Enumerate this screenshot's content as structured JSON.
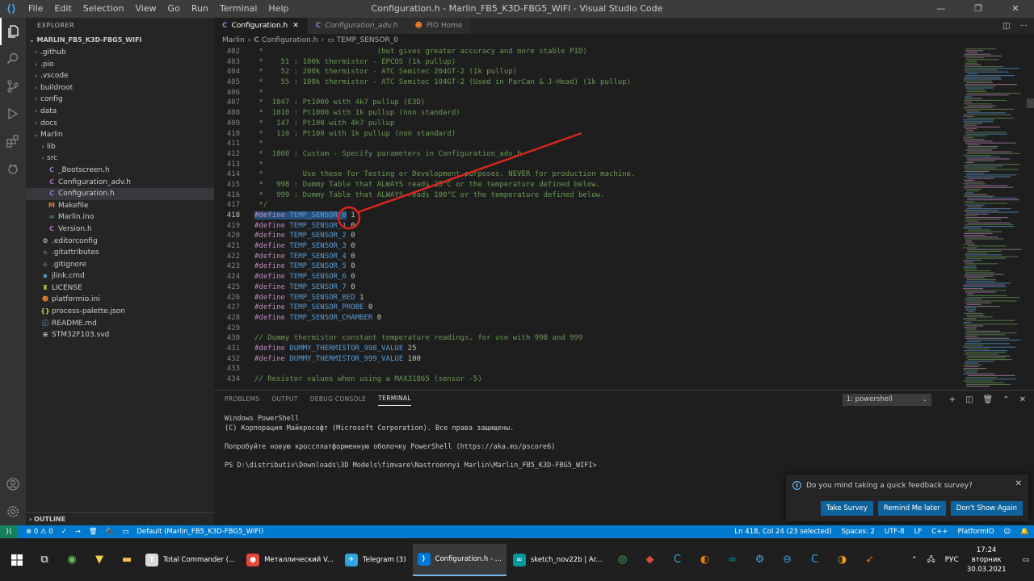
{
  "titlebar": {
    "menu": [
      "File",
      "Edit",
      "Selection",
      "View",
      "Go",
      "Run",
      "Terminal",
      "Help"
    ],
    "title": "Configuration.h - Marlin_FB5_K3D-FBG5_WIFI - Visual Studio Code"
  },
  "sidebar": {
    "header": "EXPLORER",
    "project": "MARLIN_FB5_K3D-FBG5_WIFI",
    "outline": "OUTLINE",
    "items": [
      {
        "label": ".github",
        "indent": 1,
        "chevron": "›",
        "icon": "",
        "color": "#cccccc"
      },
      {
        "label": ".pio",
        "indent": 1,
        "chevron": "›",
        "icon": "",
        "color": "#cccccc"
      },
      {
        "label": ".vscode",
        "indent": 1,
        "chevron": "›",
        "icon": "",
        "color": "#cccccc"
      },
      {
        "label": "buildroot",
        "indent": 1,
        "chevron": "›",
        "icon": "",
        "color": "#cccccc"
      },
      {
        "label": "config",
        "indent": 1,
        "chevron": "›",
        "icon": "",
        "color": "#cccccc"
      },
      {
        "label": "data",
        "indent": 1,
        "chevron": "›",
        "icon": "",
        "color": "#cccccc"
      },
      {
        "label": "docs",
        "indent": 1,
        "chevron": "›",
        "icon": "",
        "color": "#cccccc"
      },
      {
        "label": "Marlin",
        "indent": 1,
        "chevron": "⌄",
        "icon": "",
        "color": "#cccccc"
      },
      {
        "label": "lib",
        "indent": 2,
        "chevron": "›",
        "icon": "",
        "color": "#cccccc"
      },
      {
        "label": "src",
        "indent": 2,
        "chevron": "›",
        "icon": "",
        "color": "#cccccc"
      },
      {
        "label": "_Bootscreen.h",
        "indent": 2,
        "chevron": "",
        "icon": "C",
        "color": "#a074c4"
      },
      {
        "label": "Configuration_adv.h",
        "indent": 2,
        "chevron": "",
        "icon": "C",
        "color": "#a074c4"
      },
      {
        "label": "Configuration.h",
        "indent": 2,
        "chevron": "",
        "icon": "C",
        "color": "#a074c4",
        "selected": true
      },
      {
        "label": "Makefile",
        "indent": 2,
        "chevron": "",
        "icon": "M",
        "color": "#e37933"
      },
      {
        "label": "Marlin.ino",
        "indent": 2,
        "chevron": "",
        "icon": "∞",
        "color": "#519aba"
      },
      {
        "label": "Version.h",
        "indent": 2,
        "chevron": "",
        "icon": "C",
        "color": "#a074c4"
      },
      {
        "label": ".editorconfig",
        "indent": 1,
        "chevron": "",
        "icon": "⚙",
        "color": "#cccccc"
      },
      {
        "label": ".gitattributes",
        "indent": 1,
        "chevron": "",
        "icon": "◆",
        "color": "#41535b"
      },
      {
        "label": ".gitignore",
        "indent": 1,
        "chevron": "",
        "icon": "◆",
        "color": "#41535b"
      },
      {
        "label": "jlink.cmd",
        "indent": 1,
        "chevron": "",
        "icon": "▪",
        "color": "#519aba"
      },
      {
        "label": "LICENSE",
        "indent": 1,
        "chevron": "",
        "icon": "♜",
        "color": "#cbcb41"
      },
      {
        "label": "platformio.ini",
        "indent": 1,
        "chevron": "",
        "icon": "☻",
        "color": "#f5822a"
      },
      {
        "label": "process-palette.json",
        "indent": 1,
        "chevron": "",
        "icon": "{}",
        "color": "#cbcb41"
      },
      {
        "label": "README.md",
        "indent": 1,
        "chevron": "",
        "icon": "ⓘ",
        "color": "#519aba"
      },
      {
        "label": "STM32F103.svd",
        "indent": 1,
        "chevron": "",
        "icon": "≡",
        "color": "#cccccc"
      }
    ]
  },
  "tabs": [
    {
      "label": "Configuration.h",
      "active": true,
      "italic": false,
      "close": "✕"
    },
    {
      "label": "Configuration_adv.h",
      "active": false,
      "italic": true,
      "close": ""
    },
    {
      "label": "PIO Home",
      "active": false,
      "italic": false,
      "close": ""
    }
  ],
  "breadcrumb": [
    "Marlin",
    "Configuration.h",
    "TEMP_SENSOR_0"
  ],
  "code": [
    {
      "n": "402",
      "t": " *                          (but gives greater accuracy and more stable PID)",
      "k": "com"
    },
    {
      "n": "403",
      "t": " *    51 : 100k thermistor - EPCOS (1k pullup)",
      "k": "com"
    },
    {
      "n": "404",
      "t": " *    52 : 200k thermistor - ATC Semitec 204GT-2 (1k pullup)",
      "k": "com"
    },
    {
      "n": "405",
      "t": " *    55 : 100k thermistor - ATC Semitec 104GT-2 (Used in ParCan & J-Head) (1k pullup)",
      "k": "com"
    },
    {
      "n": "406",
      "t": " *",
      "k": "com"
    },
    {
      "n": "407",
      "t": " *  1047 : Pt1000 with 4k7 pullup (E3D)",
      "k": "com"
    },
    {
      "n": "408",
      "t": " *  1010 : Pt1000 with 1k pullup (non standard)",
      "k": "com"
    },
    {
      "n": "409",
      "t": " *   147 : Pt100 with 4k7 pullup",
      "k": "com"
    },
    {
      "n": "410",
      "t": " *   110 : Pt100 with 1k pullup (non standard)",
      "k": "com"
    },
    {
      "n": "411",
      "t": " *",
      "k": "com"
    },
    {
      "n": "412",
      "t": " *  1000 : Custom - Specify parameters in Configuration_adv.h",
      "k": "com"
    },
    {
      "n": "413",
      "t": " *",
      "k": "com"
    },
    {
      "n": "414",
      "t": " *         Use these for Testing or Development purposes. NEVER for production machine.",
      "k": "com"
    },
    {
      "n": "415",
      "t": " *   998 : Dummy Table that ALWAYS reads 25°C or the temperature defined below.",
      "k": "com"
    },
    {
      "n": "416",
      "t": " *   999 : Dummy Table that ALWAYS reads 100°C or the temperature defined below.",
      "k": "com"
    },
    {
      "n": "417",
      "t": " */",
      "k": "com"
    },
    {
      "n": "418",
      "kw": "#define",
      "mac": "TEMP_SENSOR_0",
      "val": "1",
      "k": "def",
      "sel": true
    },
    {
      "n": "419",
      "kw": "#define",
      "mac": "TEMP_SENSOR_1",
      "val": "0",
      "k": "def"
    },
    {
      "n": "420",
      "kw": "#define",
      "mac": "TEMP_SENSOR_2",
      "val": "0",
      "k": "def"
    },
    {
      "n": "421",
      "kw": "#define",
      "mac": "TEMP_SENSOR_3",
      "val": "0",
      "k": "def"
    },
    {
      "n": "422",
      "kw": "#define",
      "mac": "TEMP_SENSOR_4",
      "val": "0",
      "k": "def"
    },
    {
      "n": "423",
      "kw": "#define",
      "mac": "TEMP_SENSOR_5",
      "val": "0",
      "k": "def"
    },
    {
      "n": "424",
      "kw": "#define",
      "mac": "TEMP_SENSOR_6",
      "val": "0",
      "k": "def"
    },
    {
      "n": "425",
      "kw": "#define",
      "mac": "TEMP_SENSOR_7",
      "val": "0",
      "k": "def"
    },
    {
      "n": "426",
      "kw": "#define",
      "mac": "TEMP_SENSOR_BED",
      "val": "1",
      "k": "def"
    },
    {
      "n": "427",
      "kw": "#define",
      "mac": "TEMP_SENSOR_PROBE",
      "val": "0",
      "k": "def"
    },
    {
      "n": "428",
      "kw": "#define",
      "mac": "TEMP_SENSOR_CHAMBER",
      "val": "0",
      "k": "def"
    },
    {
      "n": "429",
      "t": "",
      "k": "plain"
    },
    {
      "n": "430",
      "t": "// Dummy thermistor constant temperature readings, for use with 998 and 999",
      "k": "com"
    },
    {
      "n": "431",
      "kw": "#define",
      "mac": "DUMMY_THERMISTOR_998_VALUE",
      "val": "25",
      "k": "def"
    },
    {
      "n": "432",
      "kw": "#define",
      "mac": "DUMMY_THERMISTOR_999_VALUE",
      "val": "100",
      "k": "def"
    },
    {
      "n": "433",
      "t": "",
      "k": "plain"
    },
    {
      "n": "434",
      "t": "// Resistor values when using a MAX31865 (sensor -5)",
      "k": "com"
    }
  ],
  "panel": {
    "tabs": [
      "PROBLEMS",
      "OUTPUT",
      "DEBUG CONSOLE",
      "TERMINAL"
    ],
    "active_tab": "TERMINAL",
    "terminal_select": "1: powershell",
    "terminal_lines": [
      "Windows PowerShell",
      "(C) Корпорация Майкрософт (Microsoft Corporation). Все права защищены.",
      "",
      "Попробуйте новую кроссплатформенную оболочку PowerShell (https://aka.ms/pscore6)",
      "",
      "PS D:\\distributiv\\Downloads\\3D Models\\fimvare\\Nastroennyi Marlin\\Marlin_FB5_K3D-FBG5_WIFI>"
    ]
  },
  "toast": {
    "message": "Do you mind taking a quick feedback survey?",
    "buttons": [
      "Take Survey",
      "Remind Me later",
      "Don't Show Again"
    ]
  },
  "statusbar": {
    "errors": "⊗ 0 ⚠ 0",
    "left_icons": [
      "✓",
      "→",
      "🗑",
      "🔌",
      "▭"
    ],
    "env": "Default (Marlin_FB5_K3D-FBG5_WIFI)",
    "position": "Ln 418, Col 24 (23 selected)",
    "spaces": "Spaces: 2",
    "encoding": "UTF-8",
    "eol": "LF",
    "language": "C++",
    "platformio": "PlatformIO"
  },
  "taskbar": {
    "apps": [
      {
        "label": "Total Commander (...",
        "icon": "T",
        "color": "#d9d9d9",
        "active": false
      },
      {
        "label": "Металлический V...",
        "icon": "●",
        "color": "#e8453c",
        "active": false
      },
      {
        "label": "Telegram (3)",
        "icon": "✈",
        "color": "#2ca5e0",
        "active": false
      },
      {
        "label": "Configuration.h - ...",
        "icon": "⟩",
        "color": "#0078d7",
        "active": true
      },
      {
        "label": "sketch_nov22b | Ar...",
        "icon": "∞",
        "color": "#00979d",
        "active": false
      }
    ],
    "lang": "РУС",
    "time": "17:24",
    "day": "вторник",
    "date": "30.03.2021"
  }
}
